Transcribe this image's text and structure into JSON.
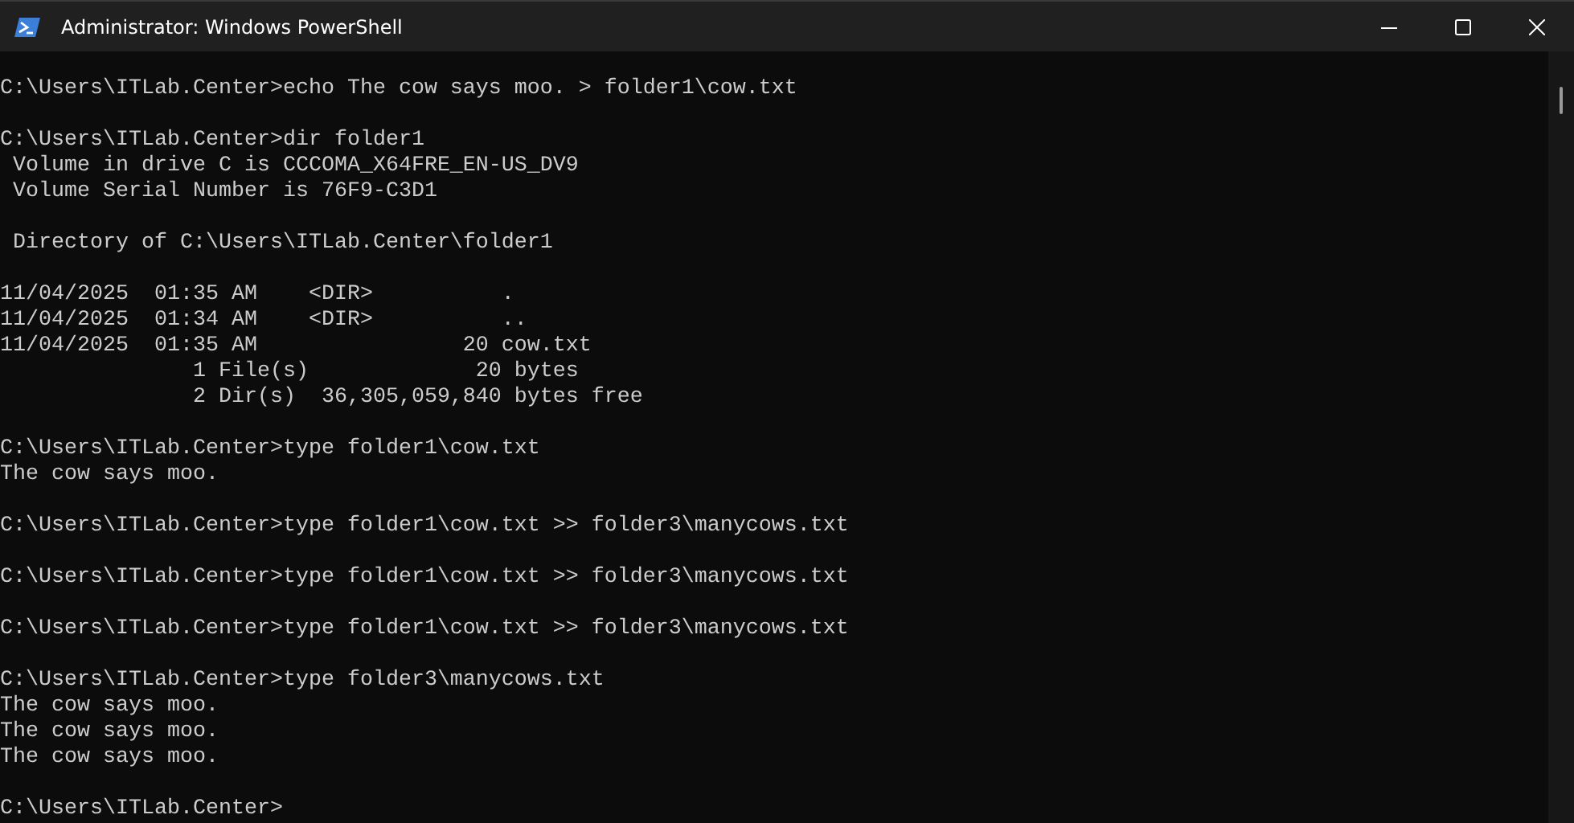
{
  "window": {
    "title": "Administrator: Windows PowerShell"
  },
  "console": {
    "blocks": [
      [
        "C:\\Users\\ITLab.Center>echo The cow says moo. > folder1\\cow.txt"
      ],
      [
        "C:\\Users\\ITLab.Center>dir folder1",
        " Volume in drive C is CCCOMA_X64FRE_EN-US_DV9",
        " Volume Serial Number is 76F9-C3D1"
      ],
      [
        " Directory of C:\\Users\\ITLab.Center\\folder1"
      ],
      [
        "11/04/2025  01:35 AM    <DIR>          .",
        "11/04/2025  01:34 AM    <DIR>          ..",
        "11/04/2025  01:35 AM                20 cow.txt",
        "               1 File(s)             20 bytes",
        "               2 Dir(s)  36,305,059,840 bytes free"
      ],
      [
        "C:\\Users\\ITLab.Center>type folder1\\cow.txt",
        "The cow says moo."
      ],
      [
        "C:\\Users\\ITLab.Center>type folder1\\cow.txt >> folder3\\manycows.txt"
      ],
      [
        "C:\\Users\\ITLab.Center>type folder1\\cow.txt >> folder3\\manycows.txt"
      ],
      [
        "C:\\Users\\ITLab.Center>type folder1\\cow.txt >> folder3\\manycows.txt"
      ],
      [
        "C:\\Users\\ITLab.Center>type folder3\\manycows.txt",
        "The cow says moo.",
        "The cow says moo.",
        "The cow says moo."
      ],
      [
        "C:\\Users\\ITLab.Center>"
      ]
    ]
  }
}
